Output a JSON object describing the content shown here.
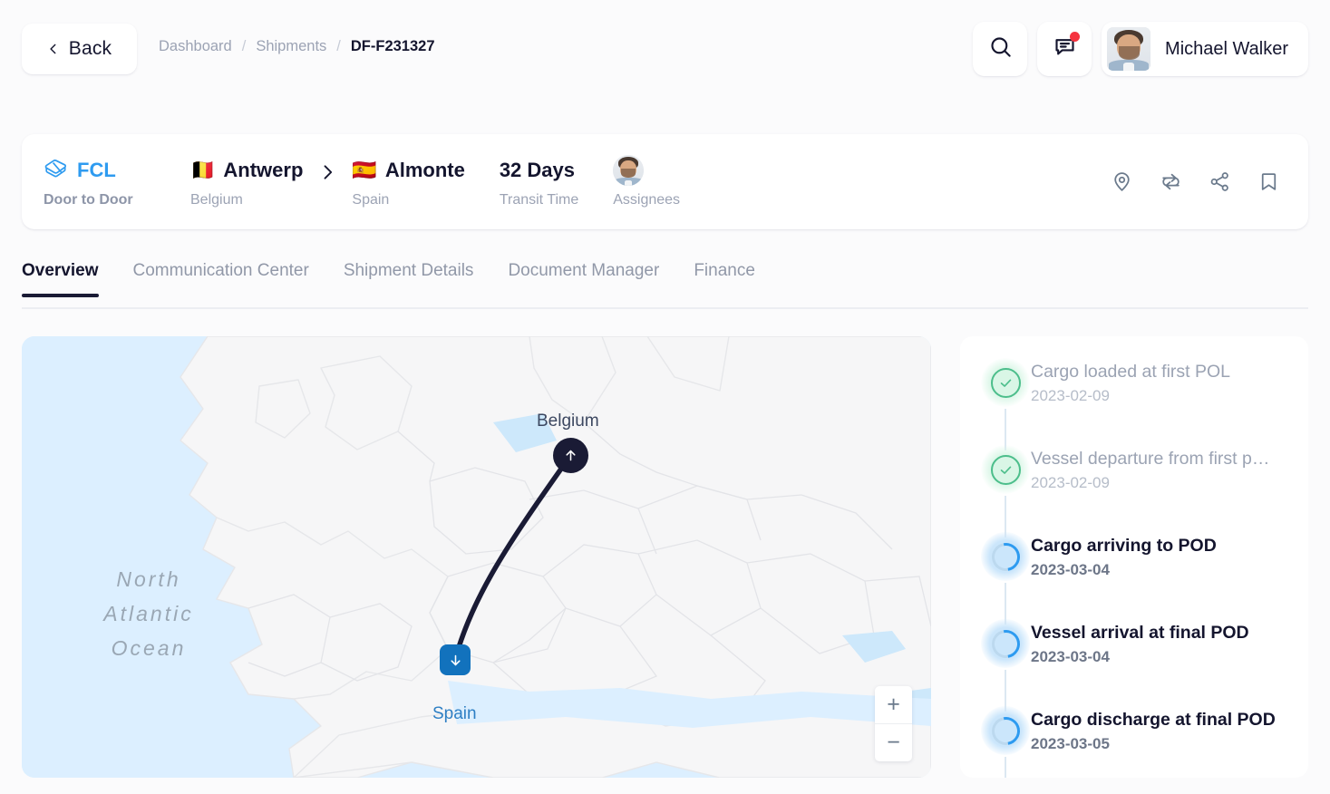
{
  "header": {
    "back_label": "Back",
    "breadcrumb": [
      {
        "label": "Dashboard",
        "current": false
      },
      {
        "label": "Shipments",
        "current": false
      },
      {
        "label": "DF-F231327",
        "current": true
      }
    ],
    "separator": "/",
    "search_icon": "search-icon",
    "messages_icon": "chat-bubble-icon",
    "has_unread": true,
    "user_name": "Michael Walker"
  },
  "shipment": {
    "mode_code": "FCL",
    "mode_sub": "Door to Door",
    "origin_city": "Antwerp",
    "origin_country": "Belgium",
    "origin_flag": "🇧🇪",
    "destination_city": "Almonte",
    "destination_country": "Spain",
    "destination_flag": "🇪🇸",
    "transit_value": "32 Days",
    "transit_label": "Transit Time",
    "assignees_label": "Assignees",
    "actions": [
      {
        "name": "track-location-icon"
      },
      {
        "name": "sync-refresh-icon"
      },
      {
        "name": "share-icon"
      },
      {
        "name": "bookmark-icon"
      }
    ]
  },
  "tabs": [
    {
      "label": "Overview",
      "active": true
    },
    {
      "label": "Communication Center",
      "active": false
    },
    {
      "label": "Shipment Details",
      "active": false
    },
    {
      "label": "Document Manager",
      "active": false
    },
    {
      "label": "Finance",
      "active": false
    }
  ],
  "map": {
    "ocean_label": "North Atlantic Ocean",
    "origin_label": "Belgium",
    "destination_label": "Spain",
    "zoom_in": "+",
    "zoom_out": "−",
    "colors": {
      "water": "#dcefff",
      "land": "#f6f6f7",
      "route": "#1a1b35",
      "origin_marker": "#1a1b35",
      "destination_marker": "#1272bd"
    }
  },
  "timeline": [
    {
      "title": "Cargo loaded at first POL",
      "date": "2023-02-09",
      "status": "done"
    },
    {
      "title": "Vessel departure from first p…",
      "date": "2023-02-09",
      "status": "done"
    },
    {
      "title": "Cargo arriving to POD",
      "date": "2023-03-04",
      "status": "pending"
    },
    {
      "title": "Vessel arrival at final POD",
      "date": "2023-03-04",
      "status": "pending"
    },
    {
      "title": "Cargo discharge at final POD",
      "date": "2023-03-05",
      "status": "pending"
    }
  ]
}
